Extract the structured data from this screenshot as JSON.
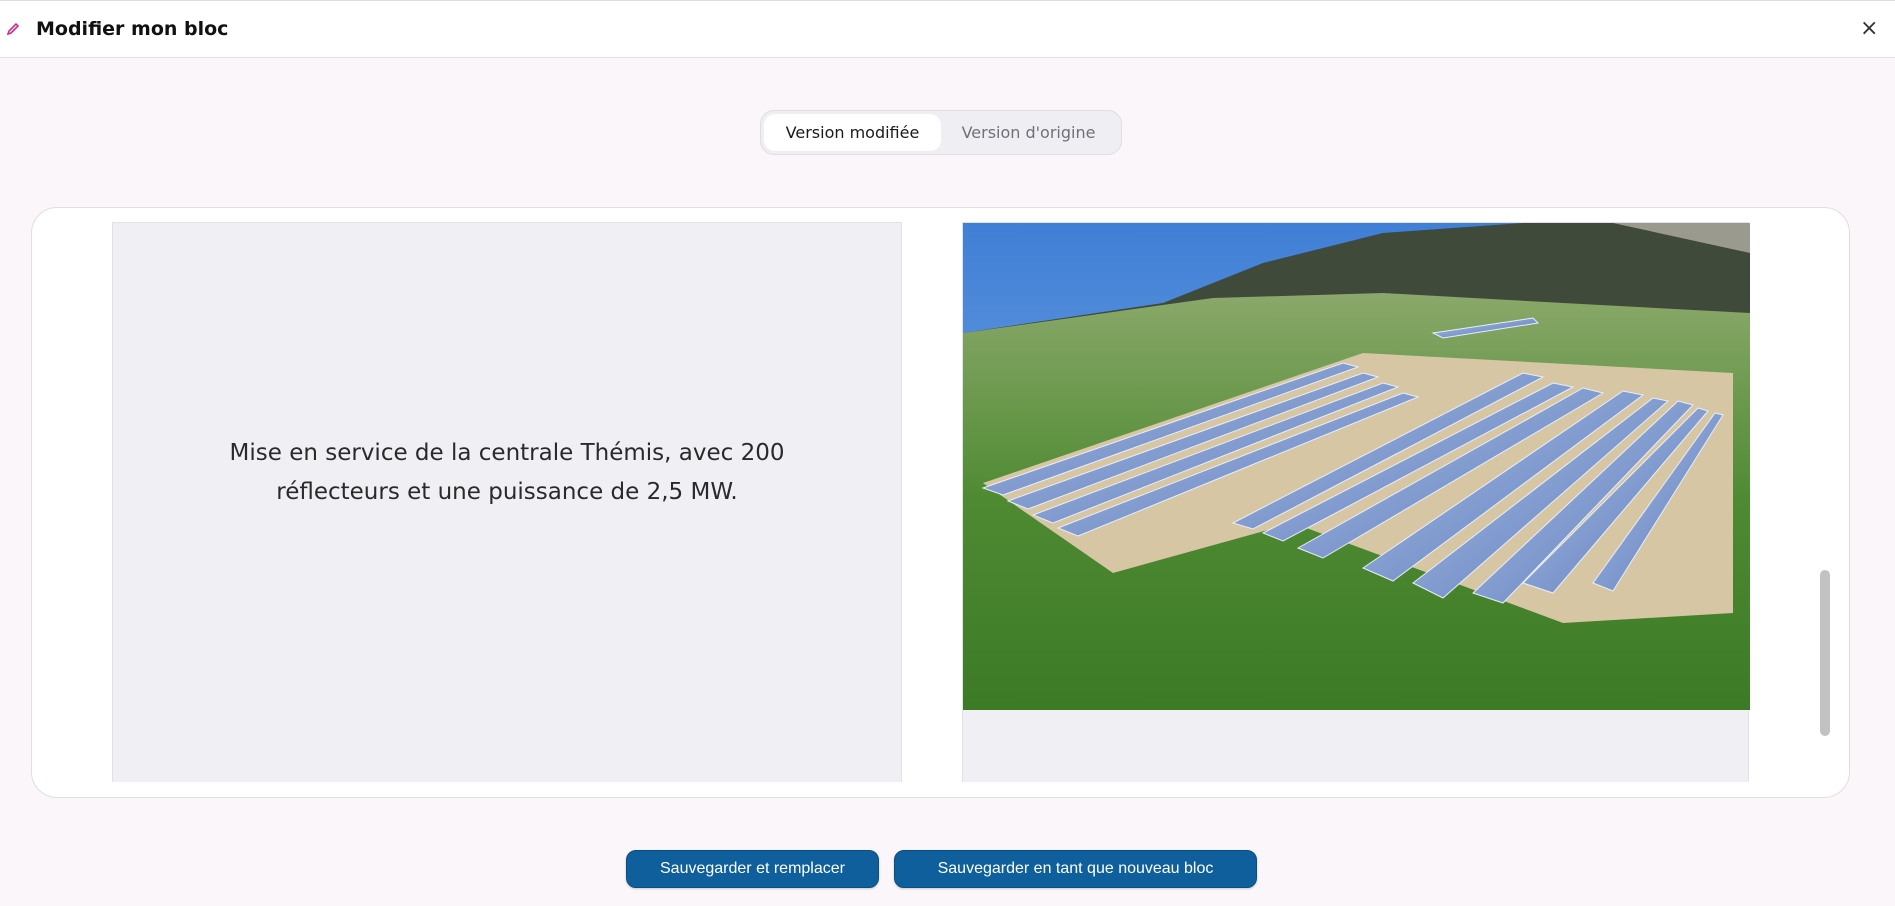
{
  "header": {
    "title": "Modifier mon bloc",
    "icon": "pencil-icon",
    "close_icon": "close-icon",
    "close_label": "×"
  },
  "toggle": {
    "tabs": [
      {
        "label": "Version modifiée",
        "active": true
      },
      {
        "label": "Version d'origine",
        "active": false
      }
    ]
  },
  "block": {
    "text": "Mise en service de la centrale Thémis, avec 200 réflecteurs et une puissance de 2,5 MW."
  },
  "actions": {
    "replace_label": "Sauvegarder et remplacer",
    "new_label": "Sauvegarder en tant que nouveau bloc"
  },
  "colors": {
    "accent": "#0e5f9c",
    "pencil": "#d62b8c"
  }
}
